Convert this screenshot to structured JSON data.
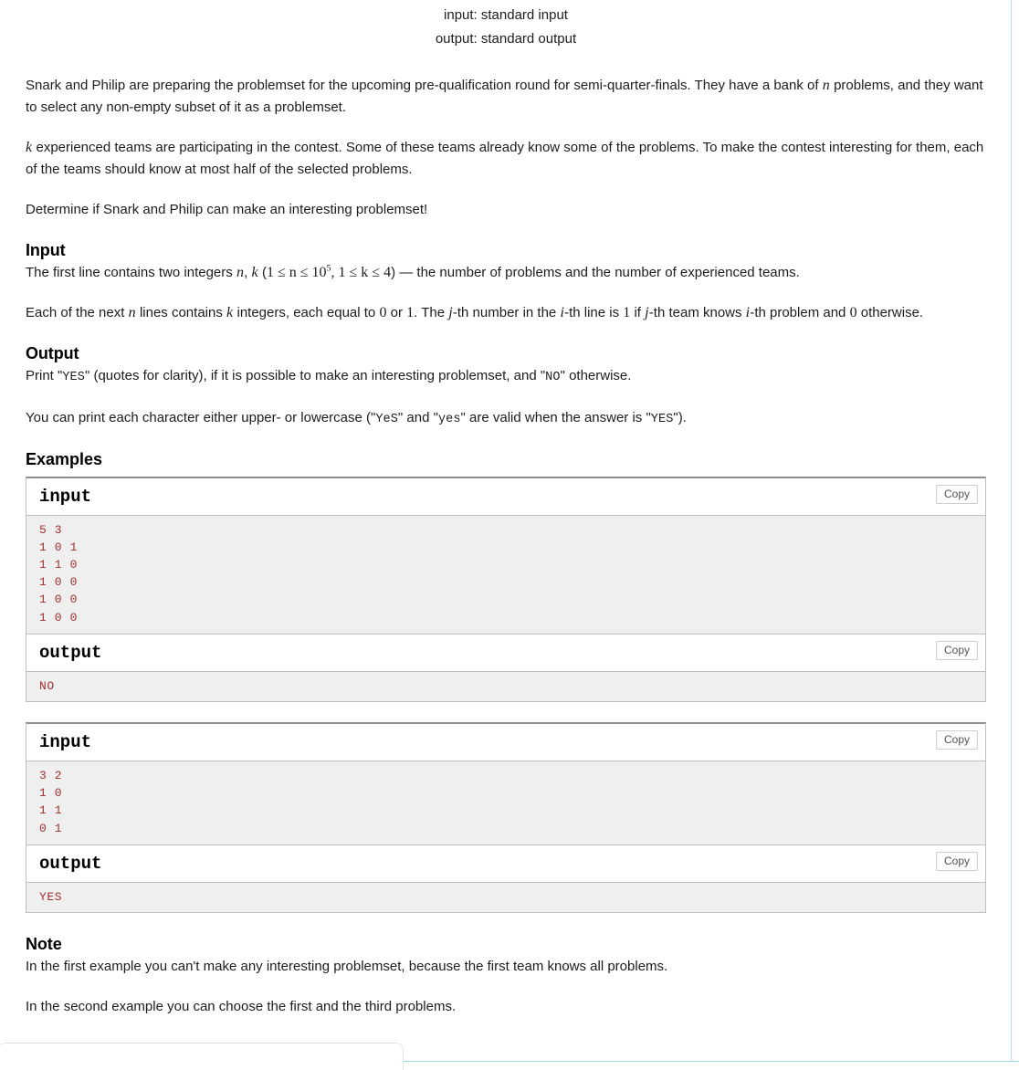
{
  "spec": {
    "input_line": "input: standard input",
    "output_line": "output: standard output"
  },
  "legend": {
    "p1_a": "Snark and Philip are preparing the problemset for the upcoming pre-qualification round for semi-quarter-finals. They have a bank of ",
    "p1_math_n": "n",
    "p1_b": " problems, and they want to select any non-empty subset of it as a problemset.",
    "p2_math_k": "k",
    "p2_a": " experienced teams are participating in the contest. Some of these teams already know some of the problems. To make the contest interesting for them, each of the teams should know at most half of the selected problems.",
    "p3": "Determine if Snark and Philip can make an interesting problemset!"
  },
  "input_section": {
    "heading": "Input",
    "p1_a": "The first line contains two integers ",
    "p1_n": "n",
    "p1_comma": ", ",
    "p1_k": "k",
    "p1_paren_open": " (",
    "p1_constraint1": "1 ≤ n ≤ 10",
    "p1_constraint1_sup": "5",
    "p1_constraint_sep": ", ",
    "p1_constraint2": "1 ≤ k ≤ 4",
    "p1_paren_close": ")",
    "p1_b": " — the number of problems and the number of experienced teams.",
    "p2_a": "Each of the next ",
    "p2_n": "n",
    "p2_b": " lines contains ",
    "p2_k": "k",
    "p2_c": " integers, each equal to ",
    "p2_zero": "0",
    "p2_d": " or ",
    "p2_one": "1",
    "p2_e": ". The ",
    "p2_j": "j",
    "p2_f": "-th number in the ",
    "p2_i": "i",
    "p2_g": "-th line is ",
    "p2_one2": "1",
    "p2_h": " if ",
    "p2_j2": "j",
    "p2_i2": "-th team knows ",
    "p2_i3": "i",
    "p2_j3": "-th problem and ",
    "p2_zero2": "0",
    "p2_k2": " otherwise."
  },
  "output_section": {
    "heading": "Output",
    "p1_a": "Print \"",
    "p1_yes": "YES",
    "p1_b": "\" (quotes for clarity), if it is possible to make an interesting problemset, and \"",
    "p1_no": "NO",
    "p1_c": "\" otherwise.",
    "p2_a": "You can print each character either upper- or lowercase (\"",
    "p2_yes_mixed": "YeS",
    "p2_b": "\" and \"",
    "p2_yes_lower": "yes",
    "p2_c": "\" are valid when the answer is \"",
    "p2_yes_upper": "YES",
    "p2_d": "\")."
  },
  "examples": {
    "heading": "Examples",
    "copy_label": "Copy",
    "input_label": "input",
    "output_label": "output",
    "tests": [
      {
        "input": "5 3\n1 0 1\n1 1 0\n1 0 0\n1 0 0\n1 0 0",
        "output": "NO"
      },
      {
        "input": "3 2\n1 0\n1 1\n0 1",
        "output": "YES"
      }
    ]
  },
  "note_section": {
    "heading": "Note",
    "p1": "In the first example you can't make any interesting problemset, because the first team knows all problems.",
    "p2": "In the second example you can choose the first and the third problems."
  },
  "colors": {
    "code_text": "#a03030",
    "code_bg": "#efefef",
    "page_rule": "#b6e0e8",
    "box_border": "#bfbfbf"
  }
}
